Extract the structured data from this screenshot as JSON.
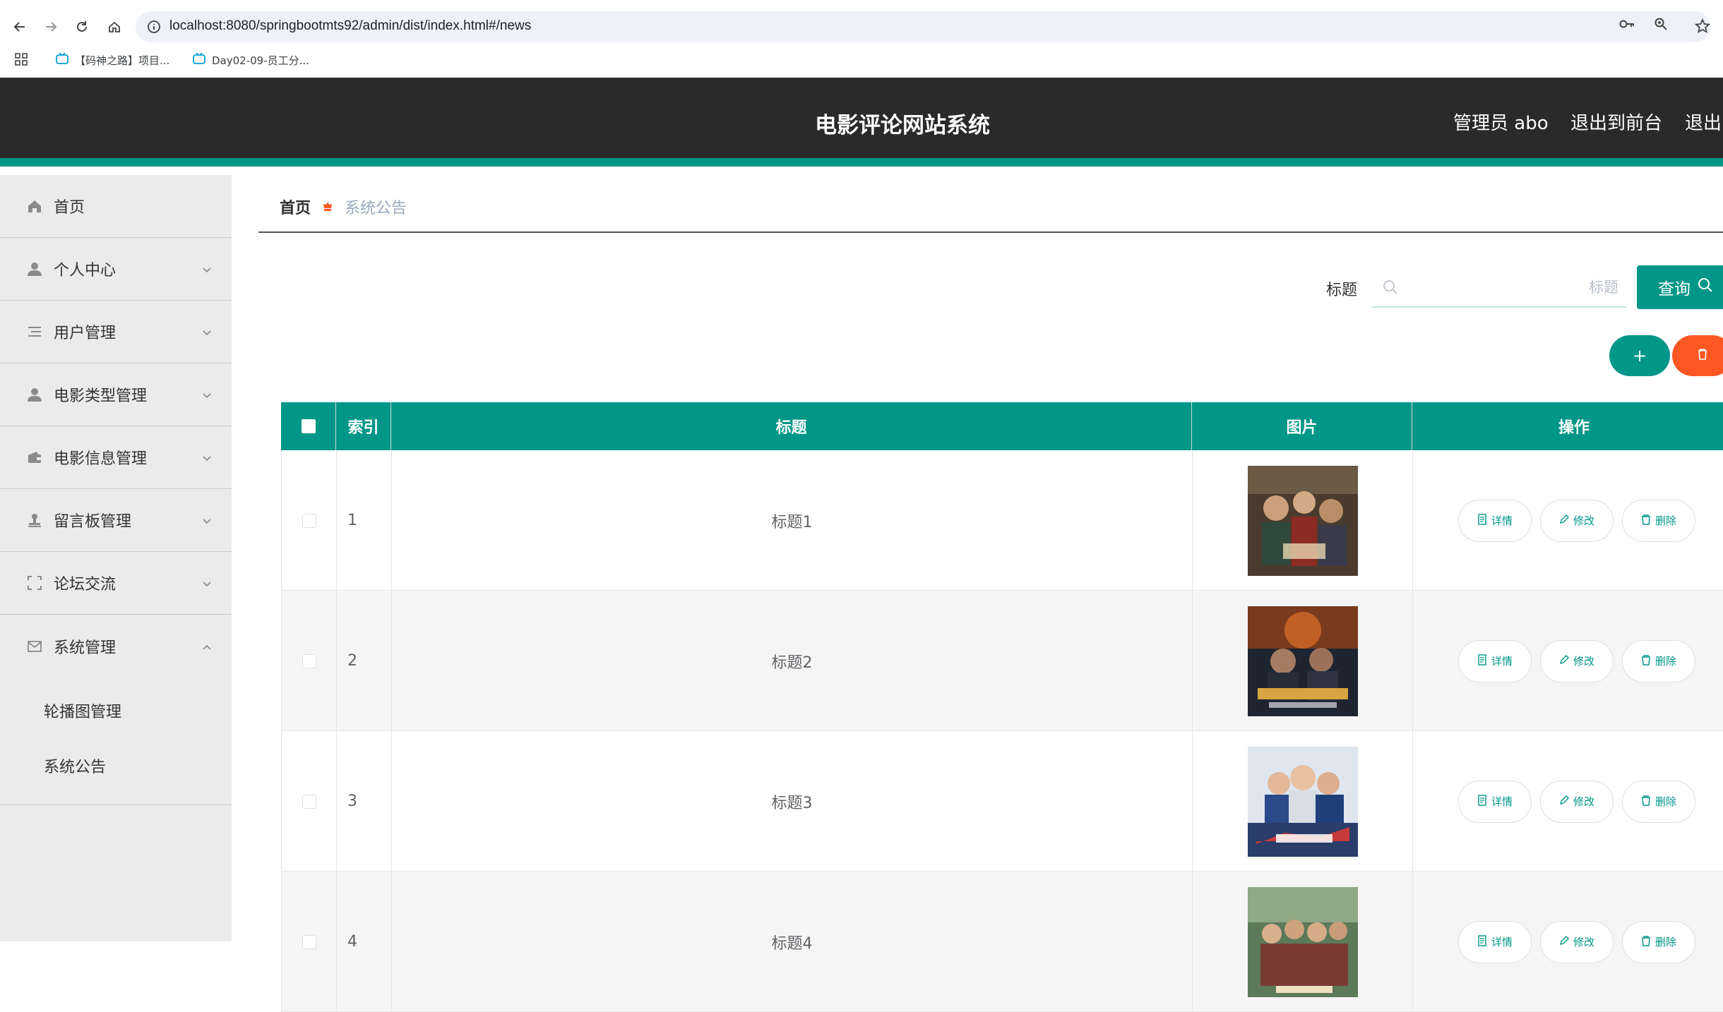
{
  "browser": {
    "url": "localhost:8080/springbootmts92/admin/dist/index.html#/news",
    "bookmarks": [
      {
        "label": "【码神之路】项目..."
      },
      {
        "label": "Day02-09-员工分..."
      }
    ]
  },
  "header": {
    "title": "电影评论网站系统",
    "user": "管理员 abo",
    "front_link": "退出到前台",
    "logout": "退出"
  },
  "sidebar": {
    "items": [
      {
        "label": "首页",
        "icon": "home-icon"
      },
      {
        "label": "个人中心",
        "icon": "user-icon"
      },
      {
        "label": "用户管理",
        "icon": "list-icon"
      },
      {
        "label": "电影类型管理",
        "icon": "user-icon"
      },
      {
        "label": "电影信息管理",
        "icon": "wallet-icon"
      },
      {
        "label": "留言板管理",
        "icon": "stamp-icon"
      },
      {
        "label": "论坛交流",
        "icon": "frame-icon"
      },
      {
        "label": "系统管理",
        "icon": "mail-icon"
      }
    ],
    "sub_items": [
      {
        "label": "轮播图管理"
      },
      {
        "label": "系统公告"
      }
    ]
  },
  "breadcrumb": {
    "home": "首页",
    "current": "系统公告"
  },
  "search": {
    "label": "标题",
    "placeholder": "标题",
    "value": "",
    "button": "查询"
  },
  "actions": {
    "add": "+"
  },
  "table": {
    "headers": [
      "索引",
      "标题",
      "图片",
      "操作"
    ],
    "rows": [
      {
        "index": "1",
        "title": "标题1"
      },
      {
        "index": "2",
        "title": "标题2"
      },
      {
        "index": "3",
        "title": "标题3"
      },
      {
        "index": "4",
        "title": "标题4"
      }
    ],
    "row_actions": {
      "detail": "详情",
      "edit": "修改",
      "delete": "删除"
    }
  },
  "colors": {
    "accent": "#009688",
    "danger": "#ff5722",
    "header_bg": "#2a2a2a",
    "sidebar_bg": "#ebebeb"
  }
}
